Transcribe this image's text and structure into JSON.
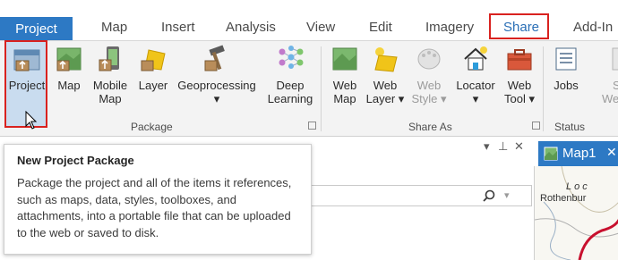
{
  "tabs": [
    {
      "label": "Project"
    },
    {
      "label": "Map"
    },
    {
      "label": "Insert"
    },
    {
      "label": "Analysis"
    },
    {
      "label": "View"
    },
    {
      "label": "Edit"
    },
    {
      "label": "Imagery"
    },
    {
      "label": "Share"
    },
    {
      "label": "Add-In"
    }
  ],
  "ribbon": {
    "buttons": [
      {
        "line1": "Project",
        "line2": ""
      },
      {
        "line1": "Map",
        "line2": ""
      },
      {
        "line1": "Mobile",
        "line2": "Map"
      },
      {
        "line1": "Layer",
        "line2": ""
      },
      {
        "line1": "Geoprocessing",
        "line2": "▾"
      },
      {
        "line1": "Deep",
        "line2": "Learning"
      },
      {
        "line1": "Web",
        "line2": "Map"
      },
      {
        "line1": "Web",
        "line2": "Layer ▾"
      },
      {
        "line1": "Web",
        "line2": "Style ▾"
      },
      {
        "line1": "Locator",
        "line2": "▾"
      },
      {
        "line1": "Web",
        "line2": "Tool ▾"
      },
      {
        "line1": "Jobs",
        "line2": ""
      },
      {
        "line1": "S",
        "line2": "We"
      }
    ],
    "groups": [
      "Package",
      "Share As",
      "Status"
    ]
  },
  "tooltip": {
    "title": "New Project Package",
    "body": "Package the project and all of the items it references, such as maps, data, styles, toolboxes, and attachments, into a portable file that can be uploaded to the web or saved to disk."
  },
  "pane": {
    "pin_glyph": "▾ ⊥ ✕",
    "search_icon": "search-icon"
  },
  "map": {
    "tab_label": "Map1",
    "labels": [
      "Loc",
      "Rothenbur"
    ]
  },
  "colors": {
    "accent": "#2d79c4",
    "highlight": "#d9221f"
  }
}
